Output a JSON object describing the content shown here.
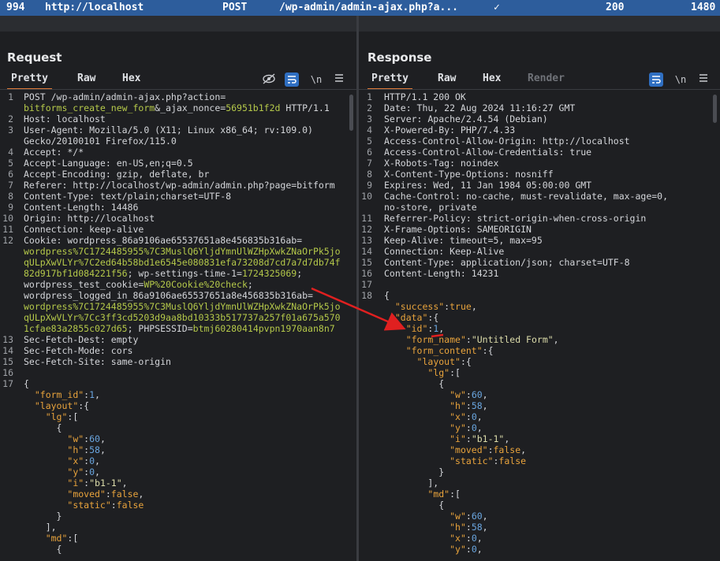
{
  "top": {
    "id": "994",
    "host": "http://localhost",
    "method": "POST",
    "path": "/wp-admin/admin-ajax.php?a...",
    "check": "✓",
    "status": "200",
    "len": "1480"
  },
  "request": {
    "title": "Request",
    "tabs": [
      "Pretty",
      "Raw",
      "Hex"
    ],
    "wrap": "\\n",
    "lines": [
      {
        "n": "1",
        "t": "POST /wp-admin/admin-ajax.php?action="
      },
      {
        "n": "",
        "t": "bitforms_create_new_form&_ajax_nonce=56951b1f2d HTTP/1.1"
      },
      {
        "n": "2",
        "t": "Host: localhost"
      },
      {
        "n": "3",
        "t": "User-Agent: Mozilla/5.0 (X11; Linux x86_64; rv:109.0)"
      },
      {
        "n": "",
        "t": "Gecko/20100101 Firefox/115.0"
      },
      {
        "n": "4",
        "t": "Accept: */*"
      },
      {
        "n": "5",
        "t": "Accept-Language: en-US,en;q=0.5"
      },
      {
        "n": "6",
        "t": "Accept-Encoding: gzip, deflate, br"
      },
      {
        "n": "7",
        "t": "Referer: http://localhost/wp-admin/admin.php?page=bitform"
      },
      {
        "n": "8",
        "t": "Content-Type: text/plain;charset=UTF-8"
      },
      {
        "n": "9",
        "t": "Content-Length: 14486"
      },
      {
        "n": "10",
        "t": "Origin: http://localhost"
      },
      {
        "n": "11",
        "t": "Connection: keep-alive"
      },
      {
        "n": "12",
        "t": "Cookie: wordpress_86a9106ae65537651a8e456835b316ab="
      },
      {
        "n": "",
        "t": "wordpress%7C1724485955%7C3MuslQ6YljdYmnUlWZHpXwkZNaOrPk5jo"
      },
      {
        "n": "",
        "t": "qULpXwVLYr%7C2ed64b58bd1e6545e080831efa73208d7cd7a7d7db74f"
      },
      {
        "n": "",
        "t": "82d917bf1d084221f56; wp-settings-time-1=1724325069;"
      },
      {
        "n": "",
        "t": "wordpress_test_cookie=WP%20Cookie%20check;"
      },
      {
        "n": "",
        "t": "wordpress_logged_in_86a9106ae65537651a8e456835b316ab="
      },
      {
        "n": "",
        "t": "wordpress%7C1724485955%7C3MuslQ6YljdYmnUlWZHpXwkZNaOrPk5jo"
      },
      {
        "n": "",
        "t": "qULpXwVLYr%7Cc3ff3cd5203d9aa8bd10333b517737a257f01a675a570"
      },
      {
        "n": "",
        "t": "1cfae83a2855c027d65; PHPSESSID=btmj60280414pvpn1970aan8n7"
      },
      {
        "n": "13",
        "t": "Sec-Fetch-Dest: empty"
      },
      {
        "n": "14",
        "t": "Sec-Fetch-Mode: cors"
      },
      {
        "n": "15",
        "t": "Sec-Fetch-Site: same-origin"
      },
      {
        "n": "16",
        "t": ""
      },
      {
        "n": "17",
        "t": "{"
      },
      {
        "n": "",
        "t": "  \"form_id\":1,"
      },
      {
        "n": "",
        "t": "  \"layout\":{"
      },
      {
        "n": "",
        "t": "    \"lg\":["
      },
      {
        "n": "",
        "t": "      {"
      },
      {
        "n": "",
        "t": "        \"w\":60,"
      },
      {
        "n": "",
        "t": "        \"h\":58,"
      },
      {
        "n": "",
        "t": "        \"x\":0,"
      },
      {
        "n": "",
        "t": "        \"y\":0,"
      },
      {
        "n": "",
        "t": "        \"i\":\"b1-1\","
      },
      {
        "n": "",
        "t": "        \"moved\":false,"
      },
      {
        "n": "",
        "t": "        \"static\":false"
      },
      {
        "n": "",
        "t": "      }"
      },
      {
        "n": "",
        "t": "    ],"
      },
      {
        "n": "",
        "t": "    \"md\":["
      },
      {
        "n": "",
        "t": "      {"
      }
    ]
  },
  "response": {
    "title": "Response",
    "tabs": [
      "Pretty",
      "Raw",
      "Hex",
      "Render"
    ],
    "wrap": "\\n",
    "lines": [
      {
        "n": "1",
        "t": "HTTP/1.1 200 OK"
      },
      {
        "n": "2",
        "t": "Date: Thu, 22 Aug 2024 11:16:27 GMT"
      },
      {
        "n": "3",
        "t": "Server: Apache/2.4.54 (Debian)"
      },
      {
        "n": "4",
        "t": "X-Powered-By: PHP/7.4.33"
      },
      {
        "n": "5",
        "t": "Access-Control-Allow-Origin: http://localhost"
      },
      {
        "n": "6",
        "t": "Access-Control-Allow-Credentials: true"
      },
      {
        "n": "7",
        "t": "X-Robots-Tag: noindex"
      },
      {
        "n": "8",
        "t": "X-Content-Type-Options: nosniff"
      },
      {
        "n": "9",
        "t": "Expires: Wed, 11 Jan 1984 05:00:00 GMT"
      },
      {
        "n": "10",
        "t": "Cache-Control: no-cache, must-revalidate, max-age=0,"
      },
      {
        "n": "",
        "t": "no-store, private"
      },
      {
        "n": "11",
        "t": "Referrer-Policy: strict-origin-when-cross-origin"
      },
      {
        "n": "12",
        "t": "X-Frame-Options: SAMEORIGIN"
      },
      {
        "n": "13",
        "t": "Keep-Alive: timeout=5, max=95"
      },
      {
        "n": "14",
        "t": "Connection: Keep-Alive"
      },
      {
        "n": "15",
        "t": "Content-Type: application/json; charset=UTF-8"
      },
      {
        "n": "16",
        "t": "Content-Length: 14231"
      },
      {
        "n": "17",
        "t": ""
      },
      {
        "n": "18",
        "t": "{"
      },
      {
        "n": "",
        "t": "  \"success\":true,"
      },
      {
        "n": "",
        "t": "  \"data\":{"
      },
      {
        "n": "",
        "t": "    \"id\":1,"
      },
      {
        "n": "",
        "t": "    \"form_name\":\"Untitled Form\","
      },
      {
        "n": "",
        "t": "    \"form_content\":{"
      },
      {
        "n": "",
        "t": "      \"layout\":{"
      },
      {
        "n": "",
        "t": "        \"lg\":["
      },
      {
        "n": "",
        "t": "          {"
      },
      {
        "n": "",
        "t": "            \"w\":60,"
      },
      {
        "n": "",
        "t": "            \"h\":58,"
      },
      {
        "n": "",
        "t": "            \"x\":0,"
      },
      {
        "n": "",
        "t": "            \"y\":0,"
      },
      {
        "n": "",
        "t": "            \"i\":\"b1-1\","
      },
      {
        "n": "",
        "t": "            \"moved\":false,"
      },
      {
        "n": "",
        "t": "            \"static\":false"
      },
      {
        "n": "",
        "t": "          }"
      },
      {
        "n": "",
        "t": "        ],"
      },
      {
        "n": "",
        "t": "        \"md\":["
      },
      {
        "n": "",
        "t": "          {"
      },
      {
        "n": "",
        "t": "            \"w\":60,"
      },
      {
        "n": "",
        "t": "            \"h\":58,"
      },
      {
        "n": "",
        "t": "            \"x\":0,"
      },
      {
        "n": "",
        "t": "            \"y\":0,"
      }
    ]
  },
  "colors": {
    "accent": "#e07b39",
    "selected": "#2d5d9c",
    "arrow": "#e02020"
  }
}
